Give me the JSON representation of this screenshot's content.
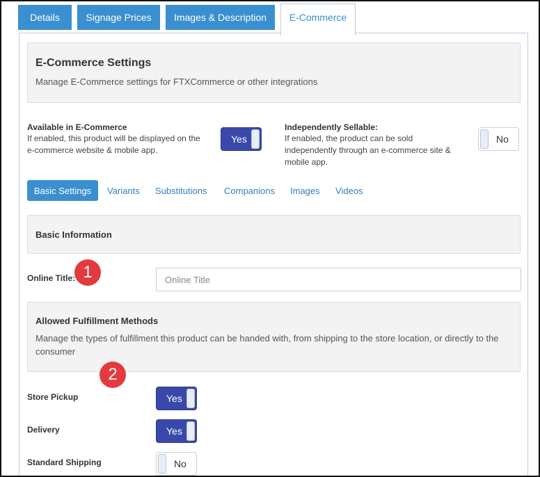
{
  "tabs": [
    {
      "label": "Details",
      "active": false
    },
    {
      "label": "Signage Prices",
      "active": false
    },
    {
      "label": "Images & Description",
      "active": false
    },
    {
      "label": "E-Commerce",
      "active": true
    }
  ],
  "ecommerce_settings": {
    "title": "E-Commerce Settings",
    "description": "Manage E-Commerce settings for FTXCommerce or other integrations"
  },
  "available": {
    "label": "Available in E-Commerce",
    "help": "If enabled, this product will be displayed on the e-commerce website & mobile app.",
    "toggle": "Yes"
  },
  "sellable": {
    "label": "Independently Sellable:",
    "help": "If enabled, the product can be sold independently through an e-commerce site & mobile app.",
    "toggle": "No"
  },
  "subtabs": [
    "Basic Settings",
    "Variants",
    "Substitutions",
    "Companions",
    "Images",
    "Videos"
  ],
  "basic_info": {
    "title": "Basic Information"
  },
  "online_title": {
    "label": "Online Title:",
    "value": "",
    "placeholder": "Online Title"
  },
  "fulfillment": {
    "title": "Allowed Fulfillment Methods",
    "description": "Manage the types of fulfillment this product can be handed with, from shipping to the store location, or directly to the consumer"
  },
  "methods": [
    {
      "label": "Store Pickup",
      "toggle": "Yes"
    },
    {
      "label": "Delivery",
      "toggle": "Yes"
    },
    {
      "label": "Standard Shipping",
      "toggle": "No"
    }
  ],
  "annotations": [
    "1",
    "2"
  ],
  "colors": {
    "tab_blue": "#3a8fd0",
    "toggle_on": "#3949ab",
    "badge_red": "#e23a3e"
  }
}
